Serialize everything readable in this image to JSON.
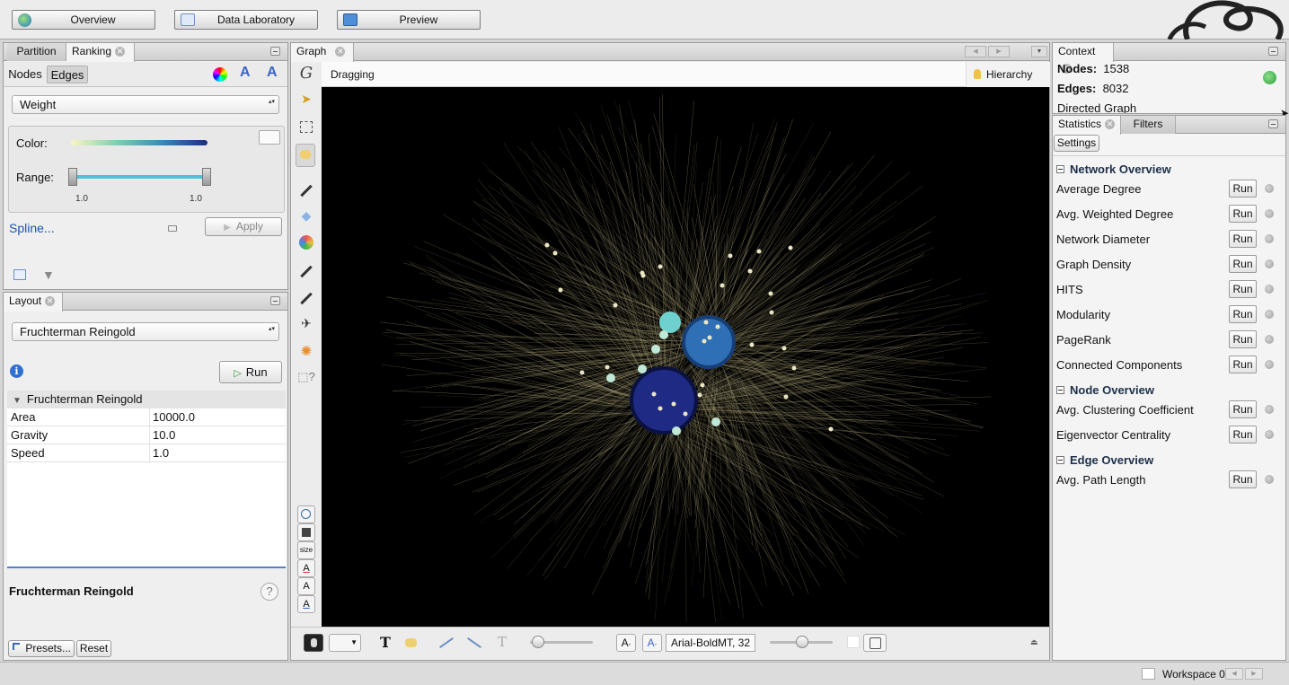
{
  "topbar": {
    "overview": "Overview",
    "data_lab": "Data Laboratory",
    "preview": "Preview"
  },
  "ranking_panel": {
    "tabs": [
      "Partition",
      "Ranking"
    ],
    "subtabs": [
      "Nodes",
      "Edges"
    ],
    "attribute": "Weight",
    "color_label": "Color:",
    "range_label": "Range:",
    "range_min": "1.0",
    "range_max": "1.0",
    "spline": "Spline...",
    "apply": "Apply"
  },
  "layout_panel": {
    "tab": "Layout",
    "algorithm": "Fruchterman Reingold",
    "run": "Run",
    "group_title": "Fruchterman Reingold",
    "properties": [
      {
        "name": "Area",
        "value": "10000.0"
      },
      {
        "name": "Gravity",
        "value": "10.0"
      },
      {
        "name": "Speed",
        "value": "1.0"
      }
    ],
    "desc_title": "Fruchterman Reingold",
    "presets": "Presets...",
    "reset": "Reset"
  },
  "graph_panel": {
    "tab": "Graph",
    "mode": "Dragging",
    "hierarchy": "Hierarchy",
    "font": "Arial-BoldMT, 32",
    "size_label": "size"
  },
  "context_panel": {
    "tab": "Context",
    "nodes_label": "Nodes:",
    "nodes_value": "1538",
    "edges_label": "Edges:",
    "edges_value": "8032",
    "graph_type": "Directed Graph"
  },
  "statistics_panel": {
    "tabs": [
      "Statistics",
      "Filters"
    ],
    "settings": "Settings",
    "run_label": "Run",
    "sections": [
      {
        "title": "Network Overview",
        "items": [
          "Average Degree",
          "Avg. Weighted Degree",
          "Network Diameter",
          "Graph Density",
          "HITS",
          "Modularity",
          "PageRank",
          "Connected Components"
        ]
      },
      {
        "title": "Node Overview",
        "items": [
          "Avg. Clustering Coefficient",
          "Eigenvector Centrality"
        ]
      },
      {
        "title": "Edge Overview",
        "items": [
          "Avg. Path Length"
        ]
      }
    ]
  },
  "statusbar": {
    "workspace": "Workspace 0"
  },
  "colors": {
    "canvas": "#000000",
    "edge": "#b7ad7e",
    "cluster_dark": "#1f2a85",
    "cluster_blue": "#2f6fb5",
    "node_light": "#bfe8d6",
    "accent_link": "#1a55b5"
  }
}
